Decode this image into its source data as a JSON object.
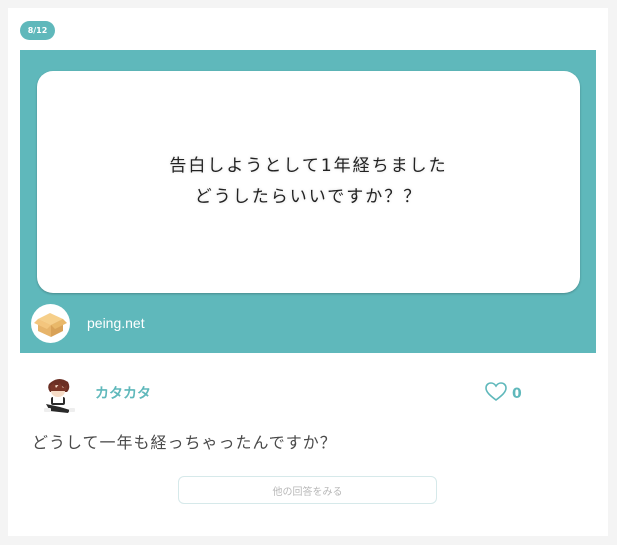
{
  "badge": {
    "page_indicator": "8/12"
  },
  "question": {
    "line1": "告白しようとして1年経ちました",
    "line2": "どうしたらいいですか？？"
  },
  "site": {
    "label": "peing.net",
    "avatar_icon": "box-icon"
  },
  "answerer": {
    "name": "カタカタ",
    "avatar_icon": "character-avatar"
  },
  "like": {
    "count": "0",
    "icon": "heart-icon"
  },
  "answer": {
    "text": "どうして一年も経っちゃったんですか？"
  },
  "more_button": {
    "label": "他の回答をみる"
  },
  "colors": {
    "accent": "#5fb8bb",
    "card": "#ffffff",
    "page": "#f4f4f4"
  }
}
